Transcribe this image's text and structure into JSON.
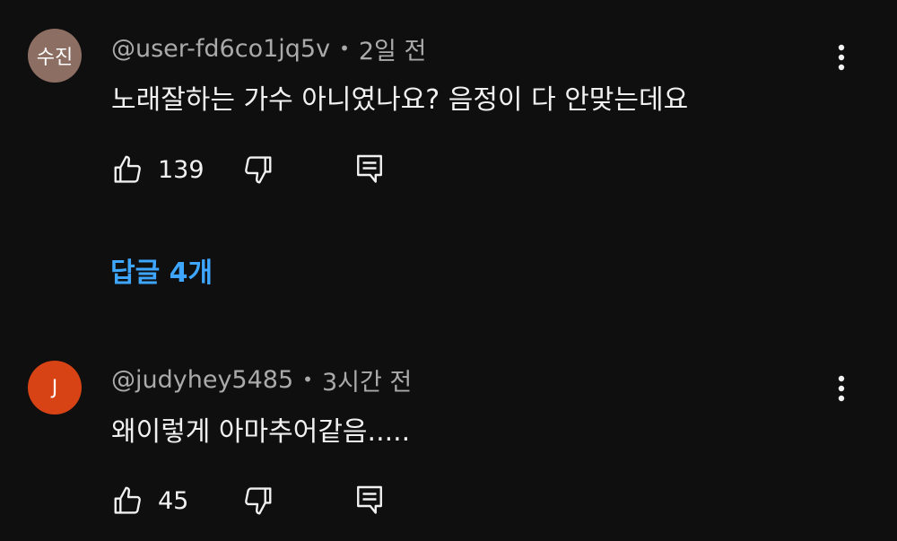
{
  "colors": {
    "background": "#0f0f0f",
    "text": "#f1f1f1",
    "meta": "#aaaaaa",
    "link": "#3ea6ff",
    "avatar1": "#8d6e63",
    "avatar2": "#d84315"
  },
  "comments": [
    {
      "avatar_text": "수진",
      "username": "@user-fd6co1jq5v",
      "separator": "•",
      "time": "2일 전",
      "text": "노래잘하는 가수 아니였나요? 음정이 다 안맞는데요",
      "likes": "139",
      "icons": [
        "thumbs-up-icon",
        "thumbs-down-icon",
        "reply-icon",
        "more-vertical-icon"
      ],
      "replies_label": "답글 4개"
    },
    {
      "avatar_text": "J",
      "username": "@judyhey5485",
      "separator": "•",
      "time": "3시간 전",
      "text": "왜이렇게 아마추어같음.....",
      "likes": "45",
      "icons": [
        "thumbs-up-icon",
        "thumbs-down-icon",
        "reply-icon",
        "more-vertical-icon"
      ]
    }
  ]
}
